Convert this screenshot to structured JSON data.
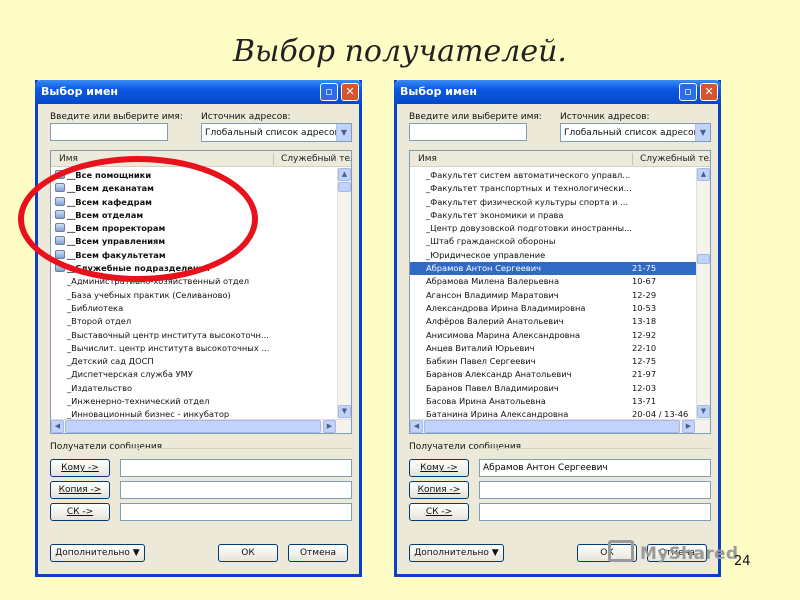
{
  "slide": {
    "title": "Выбор получателей.",
    "page_number": "24",
    "watermark": "MyShared"
  },
  "dialogs": [
    {
      "title": "Выбор имен",
      "name_label": "Введите или выберите имя:",
      "name_value": "",
      "source_label": "Источник адресов:",
      "source_value": "Глобальный список адресов",
      "col_name": "Имя",
      "col_phone": "Служебный тел",
      "rows": [
        {
          "name": "__Все помощники",
          "phone": "",
          "bold": true,
          "icon": true
        },
        {
          "name": "__Всем деканатам",
          "phone": "",
          "bold": true,
          "icon": true
        },
        {
          "name": "__Всем кафедрам",
          "phone": "",
          "bold": true,
          "icon": true
        },
        {
          "name": "__Всем отделам",
          "phone": "",
          "bold": true,
          "icon": true
        },
        {
          "name": "__Всем проректорам",
          "phone": "",
          "bold": true,
          "icon": true
        },
        {
          "name": "__Всем управлениям",
          "phone": "",
          "bold": true,
          "icon": true
        },
        {
          "name": "__Всем факультетам",
          "phone": "",
          "bold": true,
          "icon": true
        },
        {
          "name": "__Служебные подразделения",
          "phone": "",
          "bold": true,
          "icon": true
        },
        {
          "name": "_Административно-хозяйственный отдел",
          "phone": "",
          "bold": false,
          "icon": false
        },
        {
          "name": "_База учебных практик (Селиваново)",
          "phone": "",
          "bold": false,
          "icon": false
        },
        {
          "name": "_Библиотека",
          "phone": "",
          "bold": false,
          "icon": false
        },
        {
          "name": "_Второй отдел",
          "phone": "",
          "bold": false,
          "icon": false
        },
        {
          "name": "_Выставочный центр института высокоточн...",
          "phone": "",
          "bold": false,
          "icon": false
        },
        {
          "name": "_Вычислит. центр института высокоточных ...",
          "phone": "",
          "bold": false,
          "icon": false
        },
        {
          "name": "_Детский сад ДОСП",
          "phone": "",
          "bold": false,
          "icon": false
        },
        {
          "name": "_Диспетчерская служба УМУ",
          "phone": "",
          "bold": false,
          "icon": false
        },
        {
          "name": "_Издательство",
          "phone": "",
          "bold": false,
          "icon": false
        },
        {
          "name": "_Инженерно-технический отдел",
          "phone": "",
          "bold": false,
          "icon": false
        },
        {
          "name": "_Инновационный бизнес - инкубатор",
          "phone": "",
          "bold": false,
          "icon": false
        }
      ],
      "recipients_label": "Получатели сообщения",
      "to_label": "Кому ->",
      "to_value": "",
      "cc_label": "Копия ->",
      "cc_value": "",
      "bcc_label": "СК ->",
      "bcc_value": "",
      "more_label": "Дополнительно",
      "ok_label": "ОК",
      "cancel_label": "Отмена"
    },
    {
      "title": "Выбор имен",
      "name_label": "Введите или выберите имя:",
      "name_value": "",
      "source_label": "Источник адресов:",
      "source_value": "Глобальный список адресов",
      "col_name": "Имя",
      "col_phone": "Служебный тел",
      "rows": [
        {
          "name": "_Факультет систем автоматического управл...",
          "phone": "",
          "bold": false,
          "icon": false
        },
        {
          "name": "_Факультет транспортных и технологически...",
          "phone": "",
          "bold": false,
          "icon": false
        },
        {
          "name": "_Факультет физической культуры спорта и ...",
          "phone": "",
          "bold": false,
          "icon": false
        },
        {
          "name": "_Факультет экономики и права",
          "phone": "",
          "bold": false,
          "icon": false
        },
        {
          "name": "_Центр довузовской подготовки иностранны...",
          "phone": "",
          "bold": false,
          "icon": false
        },
        {
          "name": "_Штаб гражданской обороны",
          "phone": "",
          "bold": false,
          "icon": false
        },
        {
          "name": "_Юридическое управление",
          "phone": "",
          "bold": false,
          "icon": false
        },
        {
          "name": "Абрамов Антон Сергеевич",
          "phone": "21-75",
          "bold": false,
          "icon": false,
          "selected": true
        },
        {
          "name": "Абрамова Милена Валерьевна",
          "phone": "10-67",
          "bold": false,
          "icon": false
        },
        {
          "name": "Агансон Владимир Маратович",
          "phone": "12-29",
          "bold": false,
          "icon": false
        },
        {
          "name": "Александрова Ирина Владимировна",
          "phone": "10-53",
          "bold": false,
          "icon": false
        },
        {
          "name": "Алфёров Валерий Анатольевич",
          "phone": "13-18",
          "bold": false,
          "icon": false
        },
        {
          "name": "Анисимова Марина Александровна",
          "phone": "12-92",
          "bold": false,
          "icon": false
        },
        {
          "name": "Анцев Виталий Юрьевич",
          "phone": "22-10",
          "bold": false,
          "icon": false
        },
        {
          "name": "Бабкин Павел Сергеевич",
          "phone": "12-75",
          "bold": false,
          "icon": false
        },
        {
          "name": "Баранов Александр Анатольевич",
          "phone": "21-97",
          "bold": false,
          "icon": false
        },
        {
          "name": "Баранов Павел Владимирович",
          "phone": "12-03",
          "bold": false,
          "icon": false
        },
        {
          "name": "Басова Ирина Анатольевна",
          "phone": "13-71",
          "bold": false,
          "icon": false
        },
        {
          "name": "Батанина Ирина Александровна",
          "phone": "20-04 / 13-46",
          "bold": false,
          "icon": false
        }
      ],
      "recipients_label": "Получатели сообщения",
      "to_label": "Кому ->",
      "to_value": "Абрамов Антон Сергеевич",
      "cc_label": "Копия ->",
      "cc_value": "",
      "bcc_label": "СК ->",
      "bcc_value": "",
      "more_label": "Дополнительно",
      "ok_label": "ОК",
      "cancel_label": "Отмена"
    }
  ],
  "colors": {
    "background": "#fdfdc5",
    "highlight_circle": "#e8111c",
    "selection": "#316ac5"
  }
}
